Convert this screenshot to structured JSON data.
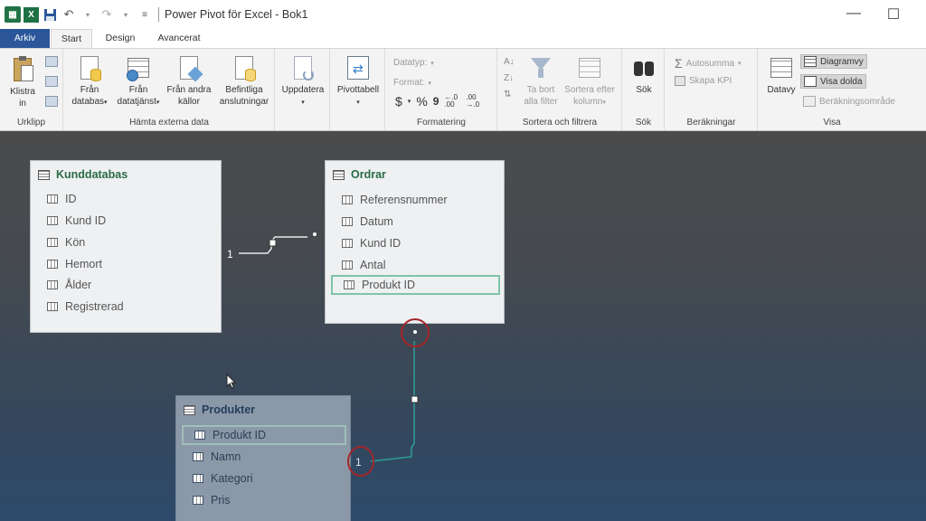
{
  "title_bar": {
    "app_icon": "PowerPivot",
    "excel_icon": "X",
    "window_title": "Power Pivot för Excel - Bok1",
    "icons": [
      "save-icon",
      "undo-icon",
      "redo-icon",
      "customize-qat-icon"
    ]
  },
  "tabs": [
    "Arkiv",
    "Start",
    "Design",
    "Avancerat"
  ],
  "ribbon": {
    "urklipp": {
      "paste": "Klistra in",
      "label": "Urklipp"
    },
    "external": {
      "from_db": "Från databas",
      "from_service": "Från datatjänst",
      "from_other": "Från andra källor",
      "existing": "Befintliga anslutningar",
      "label": "Hämta externa data"
    },
    "update": "Uppdatera",
    "pivot": "Pivottabell",
    "format": {
      "datatype": "Datatyp:",
      "format": "Format:",
      "currency": "$",
      "percent": "%",
      "comma": "9",
      "inc": "←.0 .00",
      "dec": ".00 →.0",
      "label": "Formatering"
    },
    "sort": {
      "remove": "Ta bort alla filter",
      "sort_by": "Sortera efter kolumn",
      "label": "Sortera och filtrera"
    },
    "find": {
      "button": "Sök",
      "label": "Sök"
    },
    "calc": {
      "autosum": "Autosumma",
      "kpi": "Skapa KPI",
      "label": "Beräkningar"
    },
    "view": {
      "dataview": "Datavy",
      "diagram": "Diagramvy",
      "show_hidden": "Visa dolda",
      "calc_area": "Beräkningsområde",
      "label": "Visa"
    }
  },
  "diagram": {
    "kunddatabas": {
      "title": "Kunddatabas",
      "fields": [
        "ID",
        "Kund ID",
        "Kön",
        "Hemort",
        "Ålder",
        "Registrerad"
      ]
    },
    "ordrar": {
      "title": "Ordrar",
      "fields": [
        "Referensnummer",
        "Datum",
        "Kund ID",
        "Antal",
        "Produkt ID"
      ],
      "selected": "Produkt ID"
    },
    "produkter": {
      "title": "Produkter",
      "fields": [
        "Produkt ID",
        "Namn",
        "Kategori",
        "Pris"
      ],
      "selected": "Produkt ID"
    },
    "relationships": [
      {
        "one": "1",
        "many": "*"
      },
      {
        "one": "1",
        "many": "*"
      }
    ]
  }
}
